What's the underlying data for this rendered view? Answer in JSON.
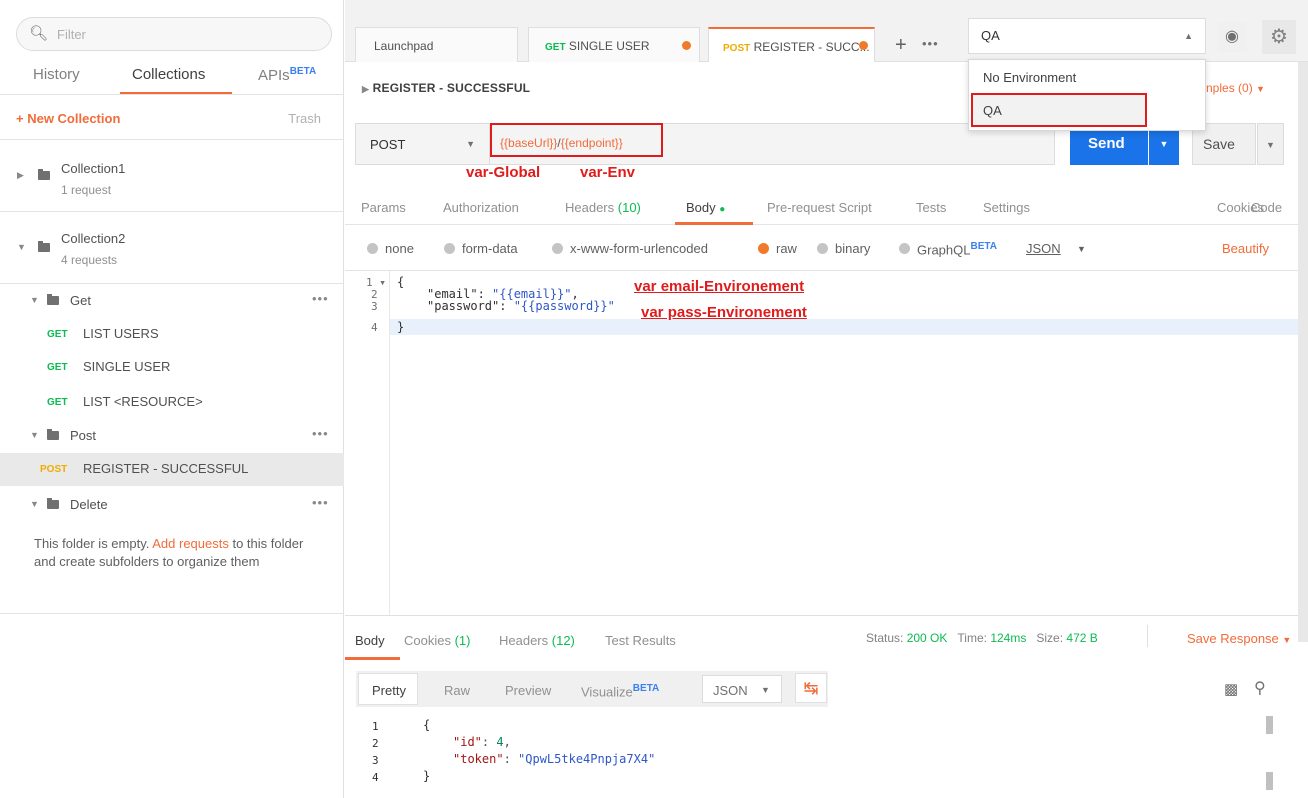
{
  "sidebar": {
    "filter_placeholder": "Filter",
    "tabs": [
      {
        "label": "History"
      },
      {
        "label": "Collections"
      },
      {
        "label": "APIs",
        "badge": "BETA"
      }
    ],
    "new_collection": "+ New Collection",
    "trash": "Trash",
    "collections": [
      {
        "name": "Collection1",
        "sub": "1 request"
      },
      {
        "name": "Collection2",
        "sub": "4 requests"
      }
    ],
    "folders": [
      {
        "name": "Get",
        "requests": [
          {
            "method": "GET",
            "name": "LIST USERS"
          },
          {
            "method": "GET",
            "name": "SINGLE USER"
          },
          {
            "method": "GET",
            "name": "LIST <RESOURCE>"
          }
        ]
      },
      {
        "name": "Post",
        "requests": [
          {
            "method": "POST",
            "name": "REGISTER - SUCCESSFUL"
          }
        ]
      },
      {
        "name": "Delete",
        "requests": []
      }
    ],
    "empty_folder": {
      "before": "This folder is empty. ",
      "link": "Add requests",
      "after": " to this folder and create subfolders to organize them"
    }
  },
  "tabs": [
    {
      "label": "Launchpad"
    },
    {
      "method": "GET",
      "label": "SINGLE USER"
    },
    {
      "method": "POST",
      "label": "REGISTER - SUCC..."
    }
  ],
  "environment": {
    "selected": "QA",
    "options": [
      "No Environment",
      "QA"
    ]
  },
  "request": {
    "title": "REGISTER - SUCCESSFUL",
    "examples": "nples (0)",
    "method": "POST",
    "url_part1": "{{baseUrl}}",
    "url_slash": "/",
    "url_part2": "{{endpoint}}",
    "send": "Send",
    "save": "Save",
    "annot_global": "var-Global",
    "annot_env": "var-Env",
    "tabs": [
      "Params",
      "Authorization",
      "Headers",
      "Body",
      "Pre-request Script",
      "Tests",
      "Settings"
    ],
    "headers_count": "(10)",
    "cookies": "Cookies",
    "code": "Code",
    "body_types": [
      "none",
      "form-data",
      "x-www-form-urlencoded",
      "raw",
      "binary",
      "GraphQL"
    ],
    "graphql_badge": "BETA",
    "format": "JSON",
    "beautify": "Beautify",
    "body_lines": {
      "l1": "{",
      "l2_key": "\"email\": ",
      "l2_val": "\"{{email}}\"",
      "l2_end": ",",
      "l3_key": "\"password\": ",
      "l3_val": "\"{{password}}\"",
      "l4": "}"
    },
    "annot_email": "var email-Environement",
    "annot_pass": "var pass-Environement"
  },
  "response": {
    "tabs": [
      "Body",
      "Cookies",
      "Headers",
      "Test Results"
    ],
    "cookies_count": "(1)",
    "headers_count": "(12)",
    "status_label": "Status:",
    "status_val": "200 OK",
    "time_label": "Time:",
    "time_val": "124ms",
    "size_label": "Size:",
    "size_val": "472 B",
    "save_response": "Save Response",
    "views": [
      "Pretty",
      "Raw",
      "Preview",
      "Visualize"
    ],
    "visualize_badge": "BETA",
    "format": "JSON",
    "lines": {
      "l1": "{",
      "l2_key": "\"id\"",
      "l2_val": "4",
      "l3_key": "\"token\"",
      "l3_val": "\"QpwL5tke4Pnpja7X4\"",
      "l4": "}"
    }
  }
}
